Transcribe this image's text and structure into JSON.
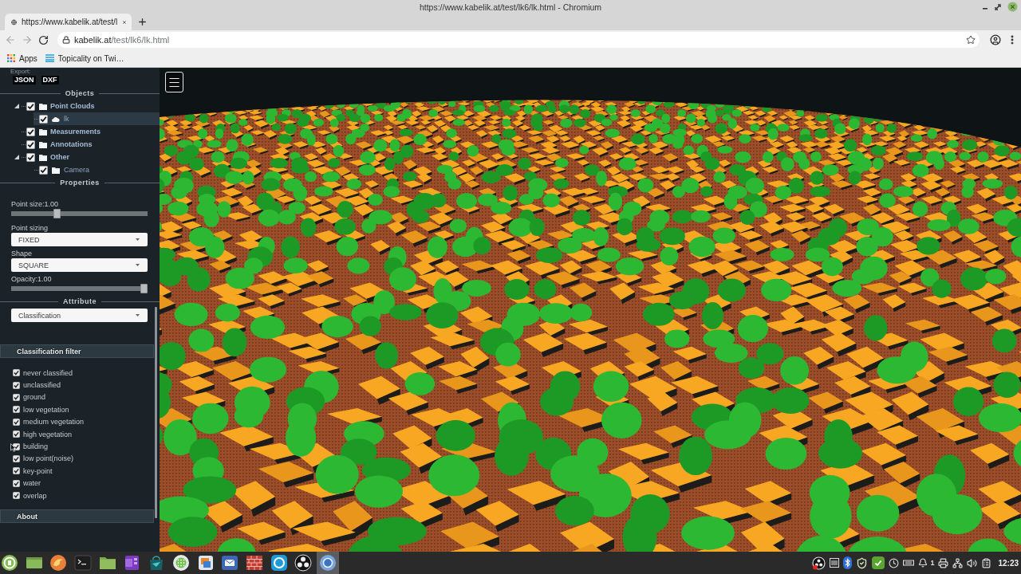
{
  "window": {
    "title": "https://www.kabelik.at/test/lk6/lk.html - Chromium"
  },
  "tabs": [
    {
      "label": "https://www.kabelik.at/test/l",
      "selected": true
    }
  ],
  "nav_buttons": [
    {
      "kind": "back",
      "disabled": true
    },
    {
      "kind": "forward",
      "disabled": true
    },
    {
      "kind": "reload",
      "disabled": false
    }
  ],
  "address_bar": {
    "domain": "kabelik.at",
    "path": "/test/lk6/lk.html"
  },
  "bookmarks": [
    {
      "kind": "apps",
      "label": "Apps"
    },
    {
      "kind": "page",
      "label": "Topicality on Twi…"
    }
  ],
  "sidebar": {
    "export": {
      "label": "Export:",
      "formats": [
        "JSON",
        "DXF"
      ]
    },
    "objects": {
      "title": "Objects",
      "tree": [
        {
          "label": "Point Clouds",
          "kind": "folder",
          "checked": true,
          "selected": false,
          "expanded": true,
          "children": [
            {
              "label": "lk",
              "kind": "cloud",
              "checked": true,
              "selected": true
            }
          ]
        },
        {
          "label": "Measurements",
          "kind": "folder",
          "checked": true,
          "selected": false
        },
        {
          "label": "Annotations",
          "kind": "folder",
          "checked": true,
          "selected": false
        },
        {
          "label": "Other",
          "kind": "folder",
          "checked": true,
          "selected": false,
          "expanded": true,
          "children": [
            {
              "label": "Camera",
              "kind": "folder",
              "checked": true,
              "selected": false
            }
          ]
        }
      ]
    },
    "properties": {
      "title": "Properties",
      "controls": [
        {
          "kind": "slider",
          "label": "Point size:1.00",
          "level": 0.33
        },
        {
          "kind": "select",
          "label": "Point sizing",
          "value": "FIXED"
        },
        {
          "kind": "select",
          "label": "Shape",
          "value": "SQUARE"
        },
        {
          "kind": "slider",
          "label": "Opacity:1.00",
          "level": 1
        }
      ]
    },
    "attribute": {
      "title": "Attribute",
      "value": "Classification"
    },
    "classification_filter": {
      "title": "Classification filter",
      "items": [
        {
          "label": "never classified",
          "checked": true
        },
        {
          "label": "unclassified",
          "checked": true
        },
        {
          "label": "ground",
          "checked": true
        },
        {
          "label": "low vegetation",
          "checked": true
        },
        {
          "label": "medium vegetation",
          "checked": true
        },
        {
          "label": "high vegetation",
          "checked": true
        },
        {
          "label": "building",
          "checked": true
        },
        {
          "label": "low point(noise)",
          "checked": true
        },
        {
          "label": "key-point",
          "checked": true
        },
        {
          "label": "water",
          "checked": true
        },
        {
          "label": "overlap",
          "checked": true
        }
      ]
    },
    "about": {
      "title": "About"
    }
  },
  "taskbar": {
    "apps": [
      {
        "kind": "menu",
        "active": false
      },
      {
        "kind": "desktop",
        "active": false
      },
      {
        "kind": "swirl",
        "active": false
      },
      {
        "kind": "terminal",
        "active": false
      },
      {
        "kind": "folder",
        "active": false
      },
      {
        "kind": "notebook",
        "active": false
      },
      {
        "kind": "bag",
        "active": false
      },
      {
        "kind": "dotgrid",
        "active": false
      },
      {
        "kind": "screens",
        "active": false
      },
      {
        "kind": "mail",
        "active": false
      },
      {
        "kind": "bricks",
        "active": false
      },
      {
        "kind": "bubble",
        "active": false
      },
      {
        "kind": "aperture",
        "active": false
      },
      {
        "kind": "orb",
        "active": true
      }
    ],
    "tray": [
      {
        "kind": "recorder"
      },
      {
        "kind": "panel"
      },
      {
        "kind": "bluetooth"
      },
      {
        "kind": "shield"
      },
      {
        "kind": "check"
      },
      {
        "kind": "clock"
      },
      {
        "kind": "card"
      },
      {
        "kind": "bell",
        "count": "1"
      },
      {
        "kind": "printer"
      },
      {
        "kind": "network"
      },
      {
        "kind": "volume"
      },
      {
        "kind": "clipboard"
      }
    ],
    "time": "12:23"
  }
}
